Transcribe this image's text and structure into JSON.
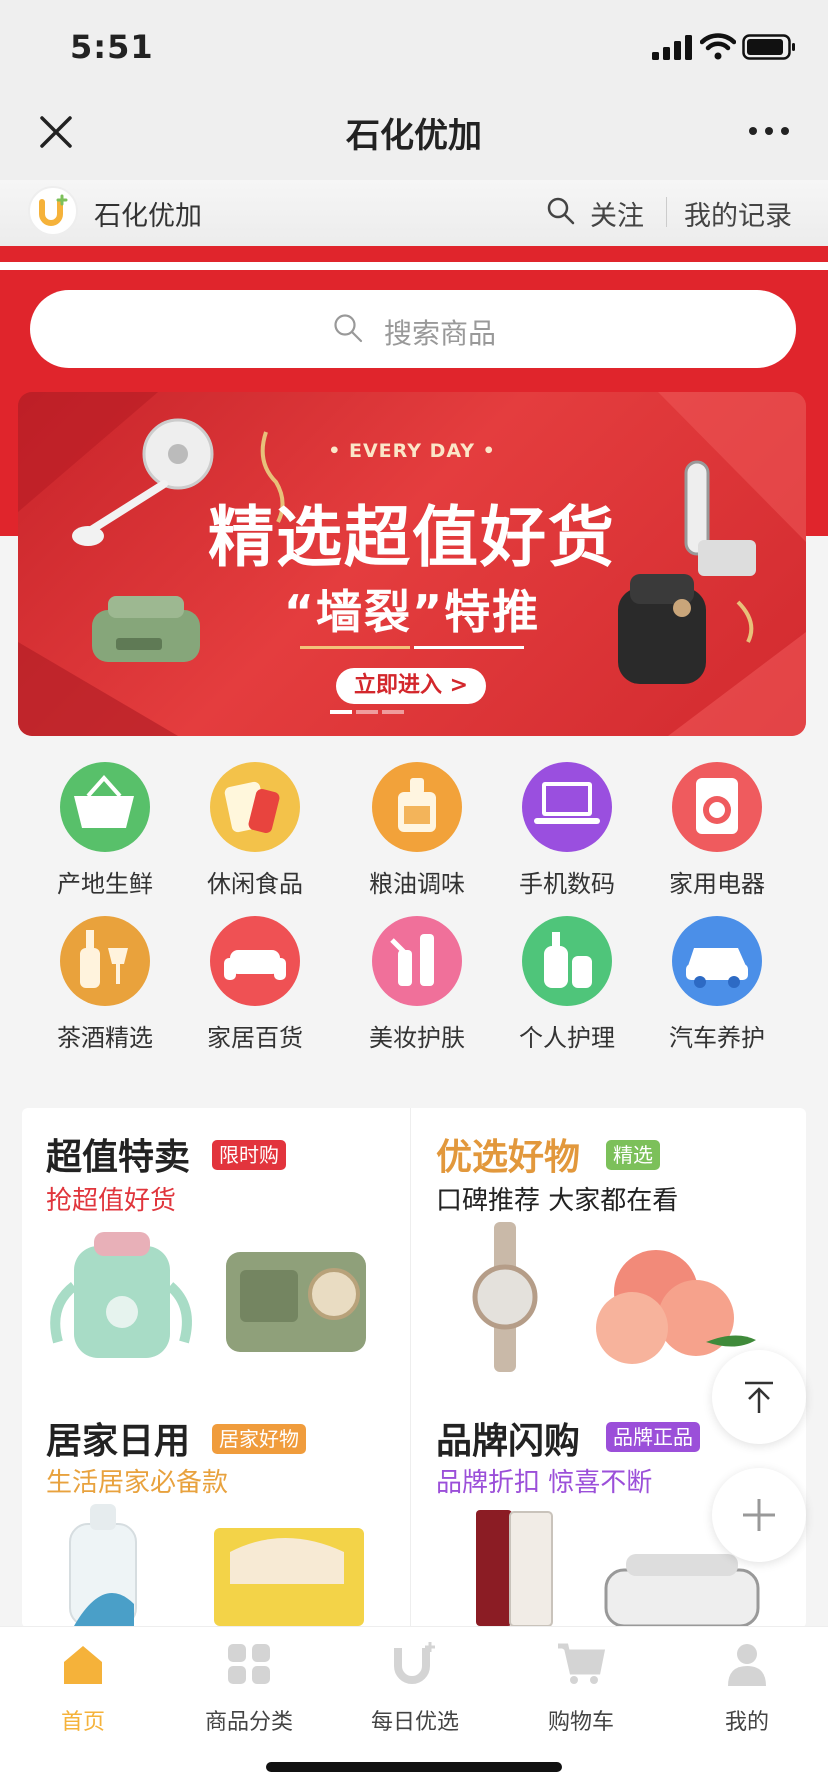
{
  "status_bar": {
    "time": "5:51"
  },
  "nav": {
    "title": "石化优加"
  },
  "store_bar": {
    "name": "石化优加",
    "follow": "关注",
    "records": "我的记录"
  },
  "search": {
    "placeholder": "搜索商品"
  },
  "banner": {
    "subtitle": "• EVERY DAY •",
    "title": "精选超值好货",
    "title2": "“墙裂”特推",
    "button": "立即进入 >"
  },
  "categories": [
    {
      "label": "产地生鲜",
      "icon": "basket-icon",
      "color": "#58c06a"
    },
    {
      "label": "休闲食品",
      "icon": "snack-icon",
      "color": "#f3c24a"
    },
    {
      "label": "粮油调味",
      "icon": "oil-bottle-icon",
      "color": "#f2a23a"
    },
    {
      "label": "手机数码",
      "icon": "laptop-icon",
      "color": "#9a4fdf"
    },
    {
      "label": "家用电器",
      "icon": "washing-machine-icon",
      "color": "#ef5b5e"
    },
    {
      "label": "茶酒精选",
      "icon": "wine-icon",
      "color": "#e9a23c"
    },
    {
      "label": "家居百货",
      "icon": "sofa-icon",
      "color": "#ef5154"
    },
    {
      "label": "美妆护肤",
      "icon": "cosmetics-icon",
      "color": "#f0709a"
    },
    {
      "label": "个人护理",
      "icon": "lotion-icon",
      "color": "#4fc57a"
    },
    {
      "label": "汽车养护",
      "icon": "car-icon",
      "color": "#4b8fe8"
    }
  ],
  "cards": [
    {
      "title": "超值特卖",
      "tag": "限时购",
      "tag_color": "#e2343d",
      "subtitle": "抢超值好货",
      "sub_color": "#e0353c"
    },
    {
      "title": "优选好物",
      "tag": "精选",
      "tag_color": "#7cc05a",
      "subtitle": "口碑推荐 大家都在看",
      "sub_color": "#222222",
      "title_color": "#e2983c"
    },
    {
      "title": "居家日用",
      "tag": "居家好物",
      "tag_color": "#f09c3c",
      "subtitle": "生活居家必备款",
      "sub_color": "#e8a23e"
    },
    {
      "title": "品牌闪购",
      "tag": "品牌正品",
      "tag_color": "#9b4fd9",
      "subtitle": "品牌折扣 惊喜不断",
      "sub_color": "#9b4fd9"
    }
  ],
  "tabs": [
    {
      "label": "首页",
      "icon": "home-icon",
      "active": true
    },
    {
      "label": "商品分类",
      "icon": "grid-icon"
    },
    {
      "label": "每日优选",
      "icon": "u-plus-icon"
    },
    {
      "label": "购物车",
      "icon": "cart-icon"
    },
    {
      "label": "我的",
      "icon": "person-icon"
    }
  ],
  "colors": {
    "brand_red": "#e0252c",
    "tab_active": "#f5b23a"
  }
}
